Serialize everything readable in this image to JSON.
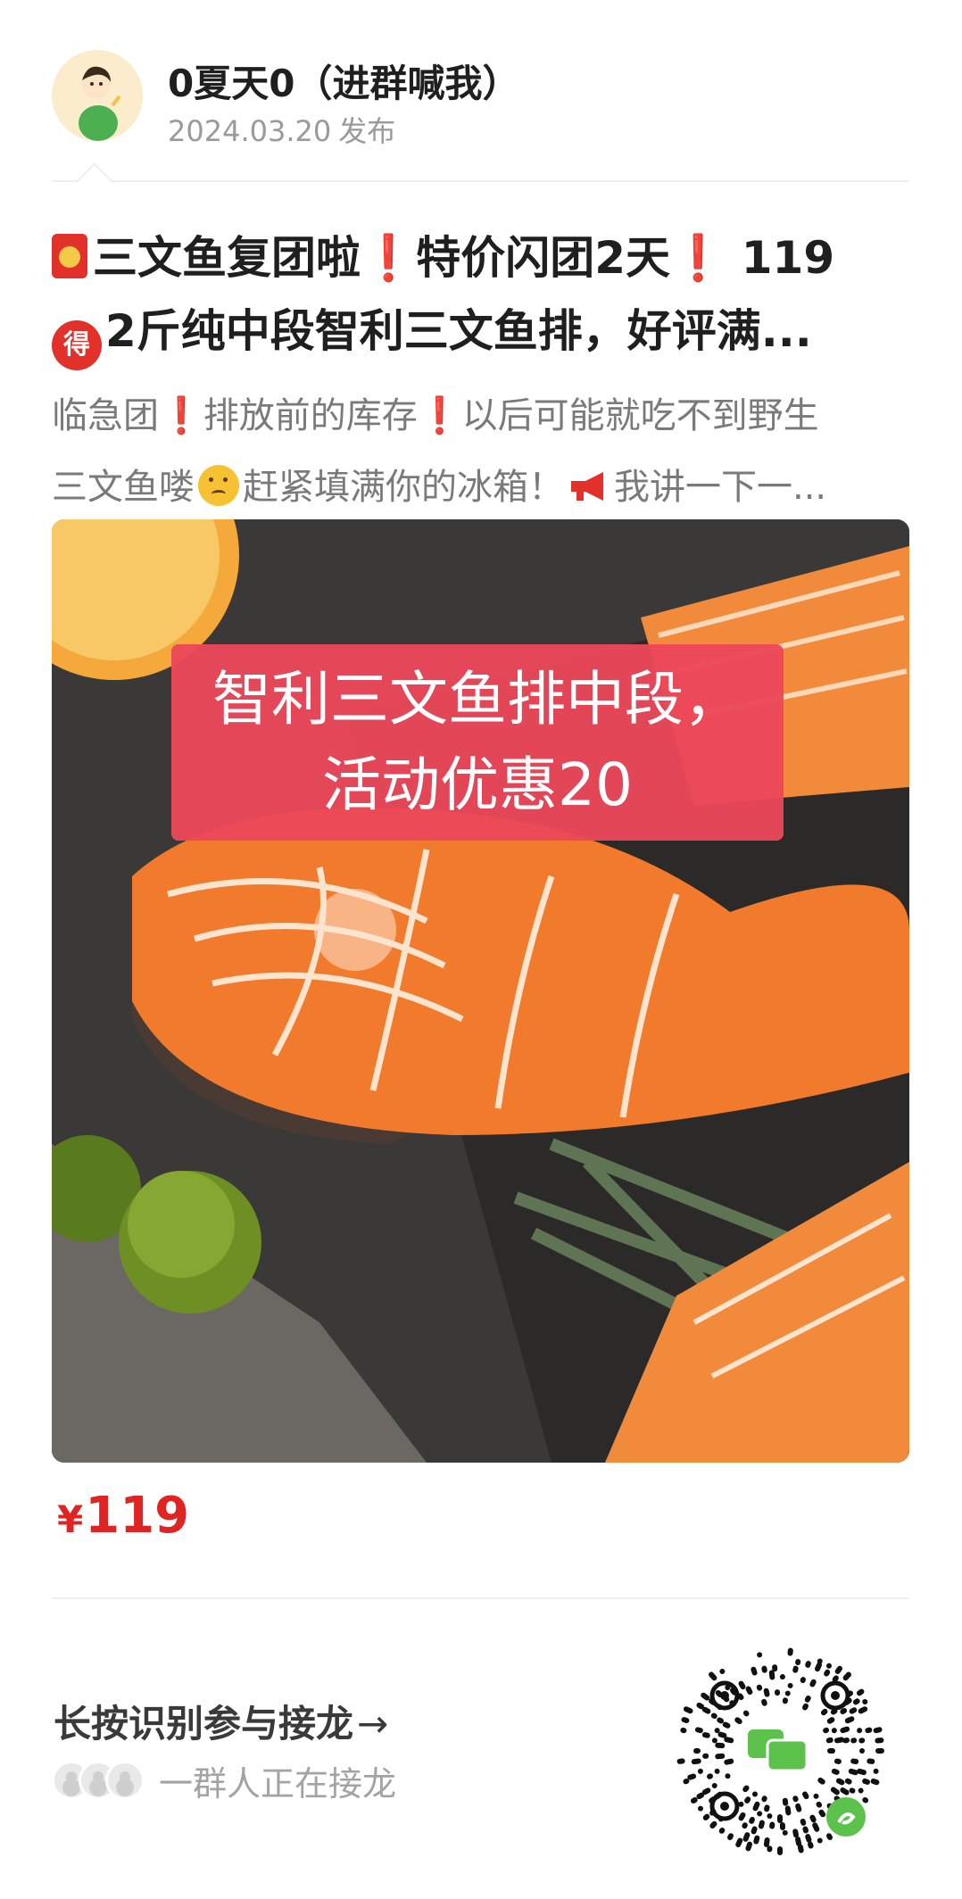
{
  "author": {
    "name": "0夏天0（进群喊我）",
    "date": "2024.03.20",
    "action": "发布"
  },
  "post": {
    "title_line1_a": "三文鱼复团啦",
    "title_line1_b": "特价闪团2天",
    "title_line1_c": " 119",
    "title_line2": "2斤纯中段智利三文鱼排，好评满...",
    "de_badge": "得",
    "excerpt_line1_a": "临急团",
    "excerpt_line1_b": "排放前的库存",
    "excerpt_line1_c": "以后可能就吃不到野生",
    "excerpt_line2_a": "三文鱼喽",
    "excerpt_line2_b": "赶紧填满你的冰箱！",
    "excerpt_line2_c": "我讲一下一...",
    "exclaim": "❗"
  },
  "photo": {
    "banner_line1": "智利三文鱼排中段，",
    "banner_line2": "活动优惠20"
  },
  "price": {
    "currency": "¥",
    "amount": "119"
  },
  "footer": {
    "cta": "长按识别参与接龙",
    "arrow": "→",
    "participants_text": "一群人正在接龙"
  },
  "colors": {
    "accent_red": "#e02323",
    "banner": "#eb485a",
    "qr_green": "#5cc24c"
  }
}
